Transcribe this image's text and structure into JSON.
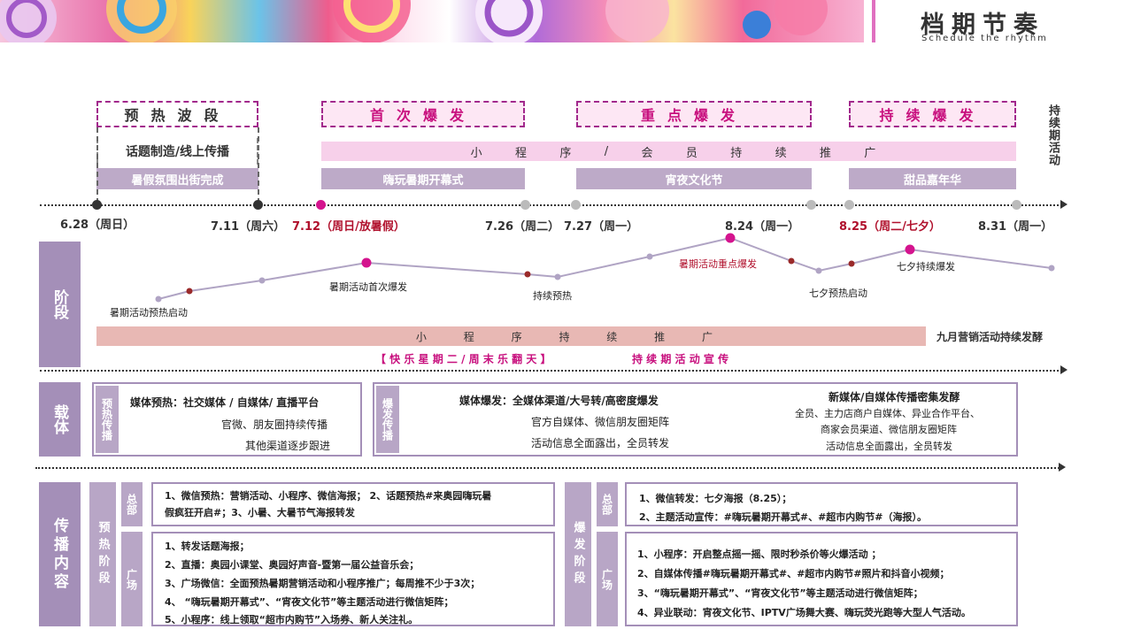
{
  "header": {
    "title": "档期节奏",
    "subtitle": "Schedule the rhythm"
  },
  "phases": [
    {
      "label": "预热波段",
      "style": "plain"
    },
    {
      "label": "首次爆发",
      "style": "pink"
    },
    {
      "label": "重点爆发",
      "style": "pink"
    },
    {
      "label": "持续爆发",
      "style": "pink"
    }
  ],
  "continue_label": "持续期活动",
  "preheat_sub": "话题制造/线上传播",
  "mini_program_bar": [
    "小",
    "程",
    "序",
    "/",
    "会",
    "员",
    "持",
    "续",
    "推",
    "广"
  ],
  "events": [
    "暑假氛围出街完成",
    "嗨玩暑期开幕式",
    "宵夜文化节",
    "甜品嘉年华"
  ],
  "dates": [
    {
      "label": "6.28（周日）",
      "red": false
    },
    {
      "label": "7.11（周六）",
      "red": false
    },
    {
      "label": "7.12（周日/放暑假）",
      "red": true
    },
    {
      "label": "7.26（周二）",
      "red": false
    },
    {
      "label": "7.27（周一）",
      "red": false
    },
    {
      "label": "8.24（周一）",
      "red": false
    },
    {
      "label": "8.25（周二/七夕）",
      "red": true
    },
    {
      "label": "8.31（周一）",
      "red": false
    }
  ],
  "stage": {
    "label": "阶段",
    "wave_labels": [
      {
        "text": "暑期活动预热启动",
        "red": false
      },
      {
        "text": "暑期活动首次爆发",
        "red": false
      },
      {
        "text": "持续预热",
        "red": false
      },
      {
        "text": "暑期活动重点爆发",
        "red": true
      },
      {
        "text": "七夕预热启动",
        "red": false
      },
      {
        "text": "七夕持续爆发",
        "red": false
      }
    ],
    "bar": [
      "小",
      "程",
      "序",
      "持",
      "续",
      "推",
      "广"
    ],
    "bar_right": "九月营销活动持续发酵",
    "slogan_left": "【 快 乐 星 期 二 / 周 末 乐 翻 天 】",
    "slogan_right": "持 续 期 活 动 宣 传"
  },
  "carrier": {
    "label": "载体",
    "preheat": {
      "tag": "预热传播",
      "title": "媒体预热：社交媒体 / 自媒体/ 直播平台",
      "lines": [
        "官微、朋友圈持续传播",
        "其他渠道逐步跟进"
      ]
    },
    "burst": {
      "tag": "爆发传播",
      "title": "媒体爆发：全媒体渠道/大号转/高密度爆发",
      "lines": [
        "官方自媒体、微信朋友圈矩阵",
        "活动信息全面露出，全员转发"
      ],
      "right_title": "新媒体/自媒体传播密集发酵",
      "right_lines": [
        "全员、主力店商户自媒体、异业合作平台、",
        "商家会员渠道、微信朋友圈矩阵",
        "活动信息全面露出，全员转发"
      ]
    }
  },
  "content": {
    "label": "传播内容",
    "preheat_stage": "预热阶段",
    "burst_stage": "爆发阶段",
    "hq": "总部",
    "plaza": "广场",
    "preheat_hq": [
      "1、微信预热：营销活动、小程序、微信海报；  2、话题预热#来奥园嗨玩暑",
      "假疯狂开启#；3、小暑、大暑节气海报转发"
    ],
    "preheat_plaza": [
      "1、转发话题海报；",
      "2、直播：奥园小课堂、奥园好声音-暨第一届公益音乐会；",
      "3、广场微信：全面预热暑期营销活动和小程序推广；每周推不少于3次；",
      "4、 “嗨玩暑期开幕式”、“宵夜文化节”等主题活动进行微信矩阵；",
      "5、小程序：线上领取“超市内购节”入场券、新人关注礼。"
    ],
    "burst_hq": [
      "1、微信转发：七夕海报（8.25）；",
      "2、主题活动宣传：#嗨玩暑期开幕式#、#超市内购节#（海报）。"
    ],
    "burst_plaza": [
      "1、小程序：开启整点摇一摇、限时秒杀价等火爆活动 ；",
      "2、自媒体传播#嗨玩暑期开幕式#、#超市内购节#照片和抖音小视频；",
      "3、“嗨玩暑期开幕式”、“宵夜文化节”等主题活动进行微信矩阵；",
      "4、异业联动：宵夜文化节、IPTV广场舞大赛、嗨玩荧光跑等大型人气活动。"
    ]
  },
  "colors": {
    "accent": "#c8107e",
    "purple": "#a48fb8",
    "pink_bar": "#f7d0ea",
    "salmon_bar": "#e8b8b4"
  }
}
